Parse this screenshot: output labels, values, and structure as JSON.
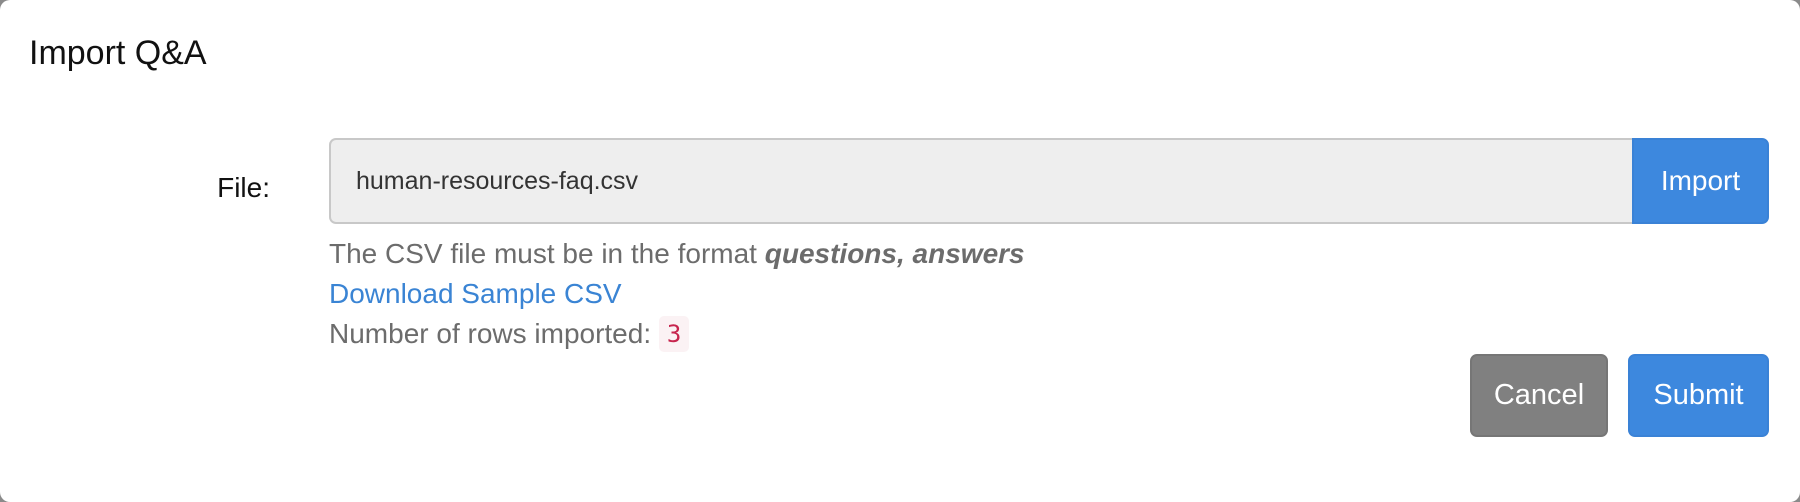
{
  "dialog": {
    "title": "Import Q&A"
  },
  "form": {
    "file_label": "File:",
    "file_value": "human-resources-faq.csv",
    "import_label": "Import"
  },
  "help": {
    "format_prefix": "The CSV file must be in the format",
    "format_value": "questions, answers",
    "sample_link": "Download Sample CSV",
    "rows_label": "Number of rows imported:",
    "rows_count": "3"
  },
  "footer": {
    "cancel_label": "Cancel",
    "submit_label": "Submit"
  },
  "colors": {
    "primary": "#3d88de",
    "secondary": "#808080",
    "link": "#3a84d4",
    "code": "#c7254e"
  }
}
